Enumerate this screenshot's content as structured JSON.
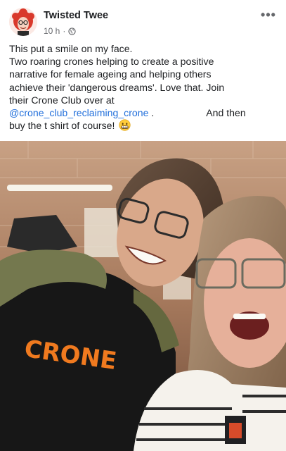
{
  "post": {
    "author": "Twisted Twee",
    "time": "10 h",
    "separator": "·",
    "audience_icon": "globe-icon",
    "more_icon": "more-options-icon",
    "more_label": "•••",
    "text": {
      "line1": "This put a smile on my face.",
      "line2": "Two roaring crones helping to create a positive",
      "line3": "narrative for female ageing and helping others",
      "line4": "achieve their 'dangerous dreams'. Love that. Join",
      "line5": "their Crone Club over at",
      "mention": "@crone_club_reclaiming_crone",
      "after_mention": " .",
      "and_then": "And then",
      "line7": "buy the t shirt of course!",
      "emoji": "grimacing-smile-emoji"
    },
    "photo": {
      "shirt_text": "CRONE"
    }
  },
  "colors": {
    "mention": "#216fdb",
    "meta": "#65676b",
    "text": "#1c1e21"
  }
}
